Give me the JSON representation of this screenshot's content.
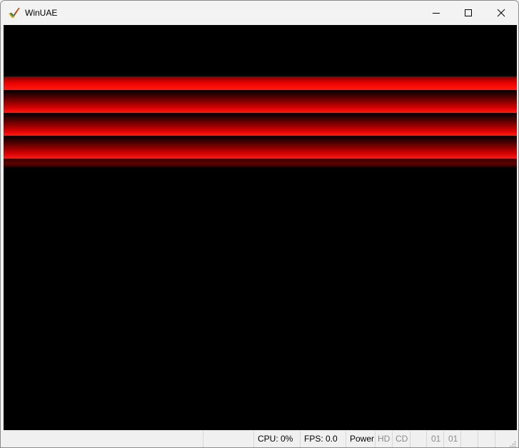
{
  "window": {
    "title": "WinUAE",
    "app_icon": "winuae-checkmark-icon",
    "controls": [
      "minimize-icon",
      "maximize-icon",
      "close-icon"
    ]
  },
  "display": {
    "background": "#000000",
    "band_color": "#ff0000"
  },
  "statusbar": {
    "cpu": "CPU: 0%",
    "fps": "FPS: 0.0",
    "power": "Power",
    "hd": "HD",
    "cd": "CD",
    "drive0": "01",
    "drive1": "01"
  }
}
